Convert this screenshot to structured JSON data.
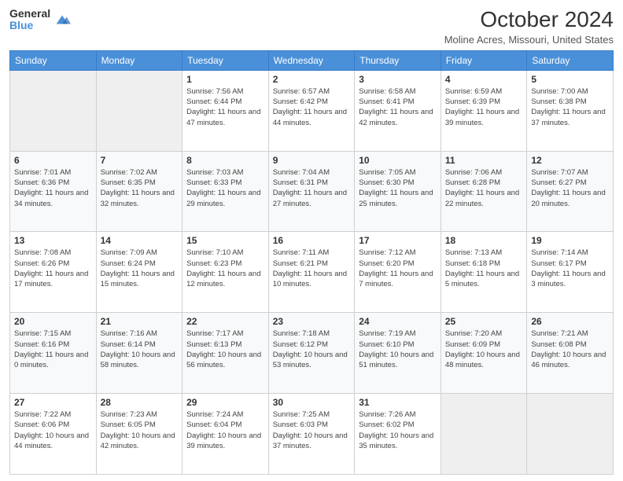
{
  "logo": {
    "general": "General",
    "blue": "Blue"
  },
  "header": {
    "title": "October 2024",
    "subtitle": "Moline Acres, Missouri, United States"
  },
  "weekdays": [
    "Sunday",
    "Monday",
    "Tuesday",
    "Wednesday",
    "Thursday",
    "Friday",
    "Saturday"
  ],
  "weeks": [
    [
      {
        "day": "",
        "empty": true
      },
      {
        "day": "",
        "empty": true
      },
      {
        "day": "1",
        "sunrise": "7:56 AM",
        "sunset": "6:44 PM",
        "daylight": "11 hours and 47 minutes."
      },
      {
        "day": "2",
        "sunrise": "6:57 AM",
        "sunset": "6:42 PM",
        "daylight": "11 hours and 44 minutes."
      },
      {
        "day": "3",
        "sunrise": "6:58 AM",
        "sunset": "6:41 PM",
        "daylight": "11 hours and 42 minutes."
      },
      {
        "day": "4",
        "sunrise": "6:59 AM",
        "sunset": "6:39 PM",
        "daylight": "11 hours and 39 minutes."
      },
      {
        "day": "5",
        "sunrise": "7:00 AM",
        "sunset": "6:38 PM",
        "daylight": "11 hours and 37 minutes."
      }
    ],
    [
      {
        "day": "6",
        "sunrise": "7:01 AM",
        "sunset": "6:36 PM",
        "daylight": "11 hours and 34 minutes."
      },
      {
        "day": "7",
        "sunrise": "7:02 AM",
        "sunset": "6:35 PM",
        "daylight": "11 hours and 32 minutes."
      },
      {
        "day": "8",
        "sunrise": "7:03 AM",
        "sunset": "6:33 PM",
        "daylight": "11 hours and 29 minutes."
      },
      {
        "day": "9",
        "sunrise": "7:04 AM",
        "sunset": "6:31 PM",
        "daylight": "11 hours and 27 minutes."
      },
      {
        "day": "10",
        "sunrise": "7:05 AM",
        "sunset": "6:30 PM",
        "daylight": "11 hours and 25 minutes."
      },
      {
        "day": "11",
        "sunrise": "7:06 AM",
        "sunset": "6:28 PM",
        "daylight": "11 hours and 22 minutes."
      },
      {
        "day": "12",
        "sunrise": "7:07 AM",
        "sunset": "6:27 PM",
        "daylight": "11 hours and 20 minutes."
      }
    ],
    [
      {
        "day": "13",
        "sunrise": "7:08 AM",
        "sunset": "6:26 PM",
        "daylight": "11 hours and 17 minutes."
      },
      {
        "day": "14",
        "sunrise": "7:09 AM",
        "sunset": "6:24 PM",
        "daylight": "11 hours and 15 minutes."
      },
      {
        "day": "15",
        "sunrise": "7:10 AM",
        "sunset": "6:23 PM",
        "daylight": "11 hours and 12 minutes."
      },
      {
        "day": "16",
        "sunrise": "7:11 AM",
        "sunset": "6:21 PM",
        "daylight": "11 hours and 10 minutes."
      },
      {
        "day": "17",
        "sunrise": "7:12 AM",
        "sunset": "6:20 PM",
        "daylight": "11 hours and 7 minutes."
      },
      {
        "day": "18",
        "sunrise": "7:13 AM",
        "sunset": "6:18 PM",
        "daylight": "11 hours and 5 minutes."
      },
      {
        "day": "19",
        "sunrise": "7:14 AM",
        "sunset": "6:17 PM",
        "daylight": "11 hours and 3 minutes."
      }
    ],
    [
      {
        "day": "20",
        "sunrise": "7:15 AM",
        "sunset": "6:16 PM",
        "daylight": "11 hours and 0 minutes."
      },
      {
        "day": "21",
        "sunrise": "7:16 AM",
        "sunset": "6:14 PM",
        "daylight": "10 hours and 58 minutes."
      },
      {
        "day": "22",
        "sunrise": "7:17 AM",
        "sunset": "6:13 PM",
        "daylight": "10 hours and 56 minutes."
      },
      {
        "day": "23",
        "sunrise": "7:18 AM",
        "sunset": "6:12 PM",
        "daylight": "10 hours and 53 minutes."
      },
      {
        "day": "24",
        "sunrise": "7:19 AM",
        "sunset": "6:10 PM",
        "daylight": "10 hours and 51 minutes."
      },
      {
        "day": "25",
        "sunrise": "7:20 AM",
        "sunset": "6:09 PM",
        "daylight": "10 hours and 48 minutes."
      },
      {
        "day": "26",
        "sunrise": "7:21 AM",
        "sunset": "6:08 PM",
        "daylight": "10 hours and 46 minutes."
      }
    ],
    [
      {
        "day": "27",
        "sunrise": "7:22 AM",
        "sunset": "6:06 PM",
        "daylight": "10 hours and 44 minutes."
      },
      {
        "day": "28",
        "sunrise": "7:23 AM",
        "sunset": "6:05 PM",
        "daylight": "10 hours and 42 minutes."
      },
      {
        "day": "29",
        "sunrise": "7:24 AM",
        "sunset": "6:04 PM",
        "daylight": "10 hours and 39 minutes."
      },
      {
        "day": "30",
        "sunrise": "7:25 AM",
        "sunset": "6:03 PM",
        "daylight": "10 hours and 37 minutes."
      },
      {
        "day": "31",
        "sunrise": "7:26 AM",
        "sunset": "6:02 PM",
        "daylight": "10 hours and 35 minutes."
      },
      {
        "day": "",
        "empty": true
      },
      {
        "day": "",
        "empty": true
      }
    ]
  ]
}
